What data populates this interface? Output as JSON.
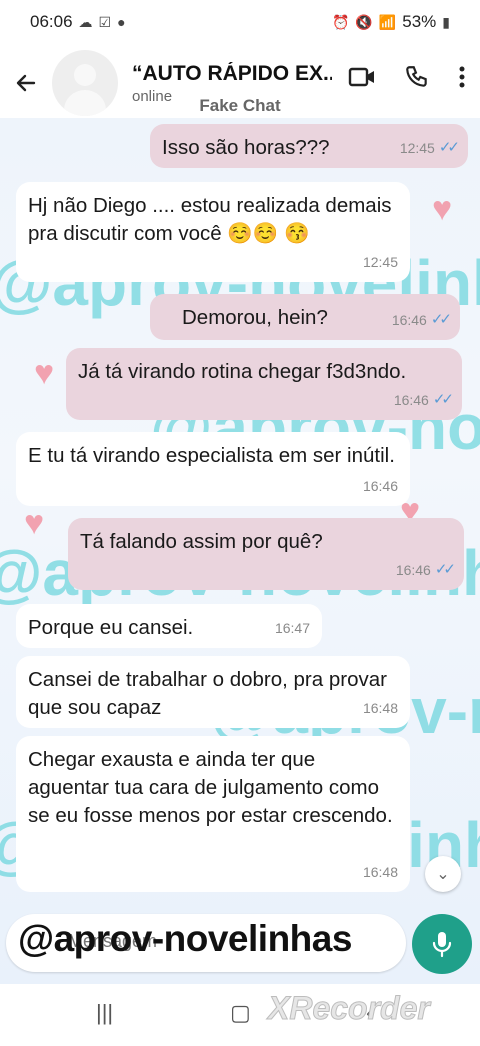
{
  "status_bar": {
    "time": "06:06",
    "battery": "53%"
  },
  "header": {
    "title": "“AUTO RÁPIDO EX...",
    "subtitle": "online",
    "overlay_label": "Fake Chat"
  },
  "messages": [
    {
      "dir": "out",
      "text": "Isso são horas???",
      "time": "12:45",
      "read": true
    },
    {
      "dir": "in",
      "text": "Hj não Diego .... estou realizada demais pra discutir com você ☺️☺️ 😚",
      "time": "12:45"
    },
    {
      "dir": "out",
      "text": "Demorou, hein?",
      "time": "16:46",
      "read": true
    },
    {
      "dir": "out",
      "text": "Já tá virando rotina chegar f3d3ndo.",
      "time": "16:46",
      "read": true
    },
    {
      "dir": "in",
      "text": "E tu tá virando especialista em ser inútil.",
      "time": "16:46"
    },
    {
      "dir": "out",
      "text": "Tá falando assim por quê?",
      "time": "16:46",
      "read": true
    },
    {
      "dir": "in",
      "text": "Porque eu cansei.",
      "time": "16:47"
    },
    {
      "dir": "in",
      "text": "Cansei de trabalhar o dobro, pra provar que sou capaz",
      "time": "16:48"
    },
    {
      "dir": "in",
      "text": "Chegar exausta e ainda ter que aguentar tua cara de julgamento como se eu fosse menos por estar crescendo.",
      "time": "16:48"
    }
  ],
  "compose": {
    "placeholder": "Mensagem"
  },
  "watermark": {
    "text": "@aprov-novelinhas",
    "recorder": "XRecorder"
  },
  "colors": {
    "accent": "#1fa08a",
    "outgoing": "#ead4dd",
    "incoming": "#ffffff",
    "ticks": "#5b9bd5"
  }
}
